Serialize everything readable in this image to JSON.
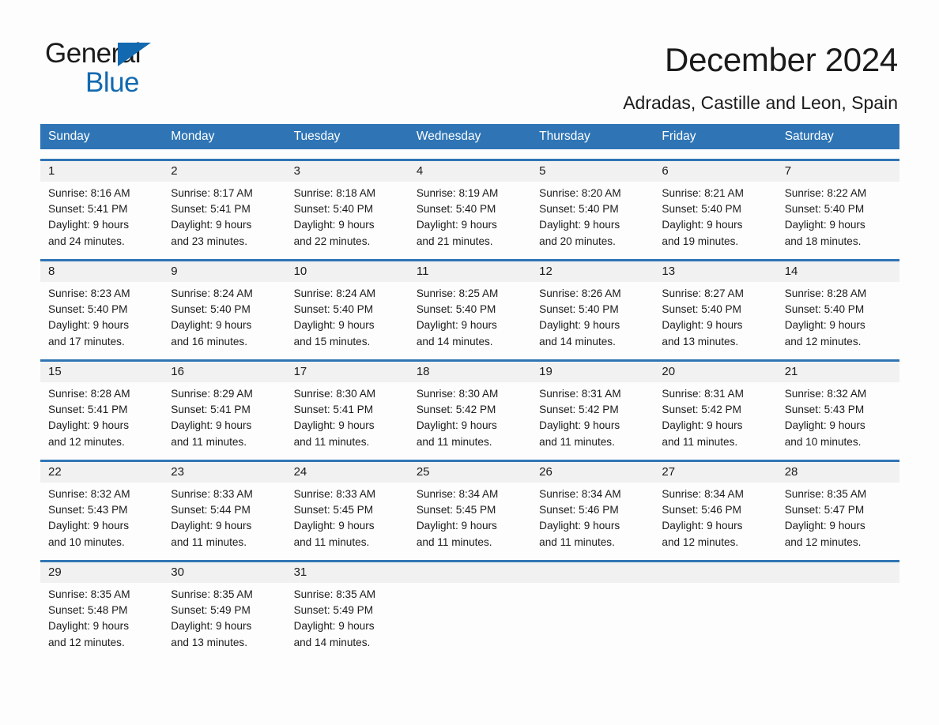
{
  "brand": {
    "logo_line1": "General",
    "logo_line2": "Blue",
    "logo_blue": "#1269b0"
  },
  "header": {
    "title": "December 2024",
    "location": "Adradas, Castille and Leon, Spain"
  },
  "theme": {
    "header_blue": "#2f75b5",
    "row_divider_blue": "#2f75b5",
    "daynum_band": "#f1f1f1",
    "page_background": "#fdfdfd",
    "text": "#1b1b1b"
  },
  "calendar": {
    "weekday_headers": [
      "Sunday",
      "Monday",
      "Tuesday",
      "Wednesday",
      "Thursday",
      "Friday",
      "Saturday"
    ],
    "weeks": [
      [
        {
          "day": "1",
          "sunrise": "Sunrise: 8:16 AM",
          "sunset": "Sunset: 5:41 PM",
          "daylight_line1": "Daylight: 9 hours",
          "daylight_line2": "and 24 minutes."
        },
        {
          "day": "2",
          "sunrise": "Sunrise: 8:17 AM",
          "sunset": "Sunset: 5:41 PM",
          "daylight_line1": "Daylight: 9 hours",
          "daylight_line2": "and 23 minutes."
        },
        {
          "day": "3",
          "sunrise": "Sunrise: 8:18 AM",
          "sunset": "Sunset: 5:40 PM",
          "daylight_line1": "Daylight: 9 hours",
          "daylight_line2": "and 22 minutes."
        },
        {
          "day": "4",
          "sunrise": "Sunrise: 8:19 AM",
          "sunset": "Sunset: 5:40 PM",
          "daylight_line1": "Daylight: 9 hours",
          "daylight_line2": "and 21 minutes."
        },
        {
          "day": "5",
          "sunrise": "Sunrise: 8:20 AM",
          "sunset": "Sunset: 5:40 PM",
          "daylight_line1": "Daylight: 9 hours",
          "daylight_line2": "and 20 minutes."
        },
        {
          "day": "6",
          "sunrise": "Sunrise: 8:21 AM",
          "sunset": "Sunset: 5:40 PM",
          "daylight_line1": "Daylight: 9 hours",
          "daylight_line2": "and 19 minutes."
        },
        {
          "day": "7",
          "sunrise": "Sunrise: 8:22 AM",
          "sunset": "Sunset: 5:40 PM",
          "daylight_line1": "Daylight: 9 hours",
          "daylight_line2": "and 18 minutes."
        }
      ],
      [
        {
          "day": "8",
          "sunrise": "Sunrise: 8:23 AM",
          "sunset": "Sunset: 5:40 PM",
          "daylight_line1": "Daylight: 9 hours",
          "daylight_line2": "and 17 minutes."
        },
        {
          "day": "9",
          "sunrise": "Sunrise: 8:24 AM",
          "sunset": "Sunset: 5:40 PM",
          "daylight_line1": "Daylight: 9 hours",
          "daylight_line2": "and 16 minutes."
        },
        {
          "day": "10",
          "sunrise": "Sunrise: 8:24 AM",
          "sunset": "Sunset: 5:40 PM",
          "daylight_line1": "Daylight: 9 hours",
          "daylight_line2": "and 15 minutes."
        },
        {
          "day": "11",
          "sunrise": "Sunrise: 8:25 AM",
          "sunset": "Sunset: 5:40 PM",
          "daylight_line1": "Daylight: 9 hours",
          "daylight_line2": "and 14 minutes."
        },
        {
          "day": "12",
          "sunrise": "Sunrise: 8:26 AM",
          "sunset": "Sunset: 5:40 PM",
          "daylight_line1": "Daylight: 9 hours",
          "daylight_line2": "and 14 minutes."
        },
        {
          "day": "13",
          "sunrise": "Sunrise: 8:27 AM",
          "sunset": "Sunset: 5:40 PM",
          "daylight_line1": "Daylight: 9 hours",
          "daylight_line2": "and 13 minutes."
        },
        {
          "day": "14",
          "sunrise": "Sunrise: 8:28 AM",
          "sunset": "Sunset: 5:40 PM",
          "daylight_line1": "Daylight: 9 hours",
          "daylight_line2": "and 12 minutes."
        }
      ],
      [
        {
          "day": "15",
          "sunrise": "Sunrise: 8:28 AM",
          "sunset": "Sunset: 5:41 PM",
          "daylight_line1": "Daylight: 9 hours",
          "daylight_line2": "and 12 minutes."
        },
        {
          "day": "16",
          "sunrise": "Sunrise: 8:29 AM",
          "sunset": "Sunset: 5:41 PM",
          "daylight_line1": "Daylight: 9 hours",
          "daylight_line2": "and 11 minutes."
        },
        {
          "day": "17",
          "sunrise": "Sunrise: 8:30 AM",
          "sunset": "Sunset: 5:41 PM",
          "daylight_line1": "Daylight: 9 hours",
          "daylight_line2": "and 11 minutes."
        },
        {
          "day": "18",
          "sunrise": "Sunrise: 8:30 AM",
          "sunset": "Sunset: 5:42 PM",
          "daylight_line1": "Daylight: 9 hours",
          "daylight_line2": "and 11 minutes."
        },
        {
          "day": "19",
          "sunrise": "Sunrise: 8:31 AM",
          "sunset": "Sunset: 5:42 PM",
          "daylight_line1": "Daylight: 9 hours",
          "daylight_line2": "and 11 minutes."
        },
        {
          "day": "20",
          "sunrise": "Sunrise: 8:31 AM",
          "sunset": "Sunset: 5:42 PM",
          "daylight_line1": "Daylight: 9 hours",
          "daylight_line2": "and 11 minutes."
        },
        {
          "day": "21",
          "sunrise": "Sunrise: 8:32 AM",
          "sunset": "Sunset: 5:43 PM",
          "daylight_line1": "Daylight: 9 hours",
          "daylight_line2": "and 10 minutes."
        }
      ],
      [
        {
          "day": "22",
          "sunrise": "Sunrise: 8:32 AM",
          "sunset": "Sunset: 5:43 PM",
          "daylight_line1": "Daylight: 9 hours",
          "daylight_line2": "and 10 minutes."
        },
        {
          "day": "23",
          "sunrise": "Sunrise: 8:33 AM",
          "sunset": "Sunset: 5:44 PM",
          "daylight_line1": "Daylight: 9 hours",
          "daylight_line2": "and 11 minutes."
        },
        {
          "day": "24",
          "sunrise": "Sunrise: 8:33 AM",
          "sunset": "Sunset: 5:45 PM",
          "daylight_line1": "Daylight: 9 hours",
          "daylight_line2": "and 11 minutes."
        },
        {
          "day": "25",
          "sunrise": "Sunrise: 8:34 AM",
          "sunset": "Sunset: 5:45 PM",
          "daylight_line1": "Daylight: 9 hours",
          "daylight_line2": "and 11 minutes."
        },
        {
          "day": "26",
          "sunrise": "Sunrise: 8:34 AM",
          "sunset": "Sunset: 5:46 PM",
          "daylight_line1": "Daylight: 9 hours",
          "daylight_line2": "and 11 minutes."
        },
        {
          "day": "27",
          "sunrise": "Sunrise: 8:34 AM",
          "sunset": "Sunset: 5:46 PM",
          "daylight_line1": "Daylight: 9 hours",
          "daylight_line2": "and 12 minutes."
        },
        {
          "day": "28",
          "sunrise": "Sunrise: 8:35 AM",
          "sunset": "Sunset: 5:47 PM",
          "daylight_line1": "Daylight: 9 hours",
          "daylight_line2": "and 12 minutes."
        }
      ],
      [
        {
          "day": "29",
          "sunrise": "Sunrise: 8:35 AM",
          "sunset": "Sunset: 5:48 PM",
          "daylight_line1": "Daylight: 9 hours",
          "daylight_line2": "and 12 minutes."
        },
        {
          "day": "30",
          "sunrise": "Sunrise: 8:35 AM",
          "sunset": "Sunset: 5:49 PM",
          "daylight_line1": "Daylight: 9 hours",
          "daylight_line2": "and 13 minutes."
        },
        {
          "day": "31",
          "sunrise": "Sunrise: 8:35 AM",
          "sunset": "Sunset: 5:49 PM",
          "daylight_line1": "Daylight: 9 hours",
          "daylight_line2": "and 14 minutes."
        },
        {
          "day": "",
          "sunrise": "",
          "sunset": "",
          "daylight_line1": "",
          "daylight_line2": ""
        },
        {
          "day": "",
          "sunrise": "",
          "sunset": "",
          "daylight_line1": "",
          "daylight_line2": ""
        },
        {
          "day": "",
          "sunrise": "",
          "sunset": "",
          "daylight_line1": "",
          "daylight_line2": ""
        },
        {
          "day": "",
          "sunrise": "",
          "sunset": "",
          "daylight_line1": "",
          "daylight_line2": ""
        }
      ]
    ]
  }
}
